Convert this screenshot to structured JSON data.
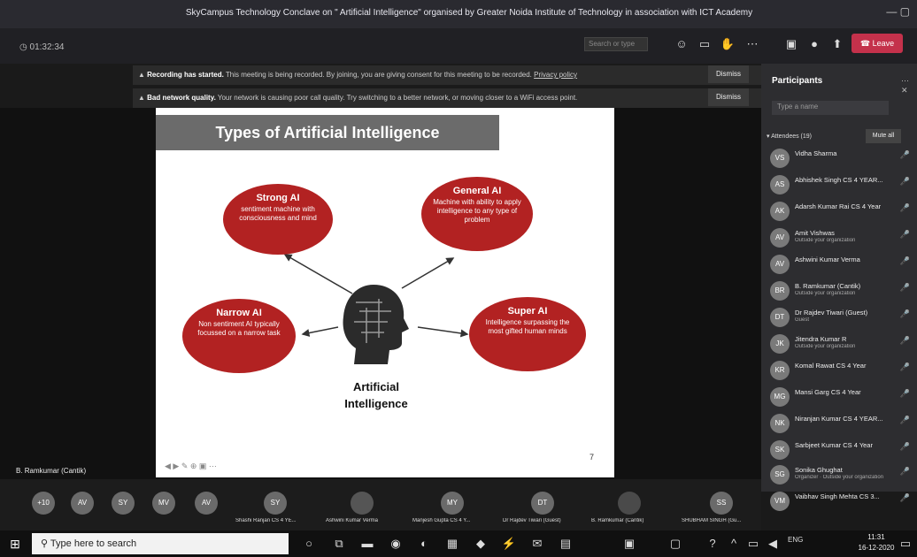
{
  "window": {
    "title": "SkyCampus Technology Conclave on \" Artificial Intelligence\" organised by Greater Noida Institute of Technology in association with ICT Academy"
  },
  "meeting": {
    "timer": "01:32:34",
    "search_placeholder": "Search or type",
    "leave_label": "Leave"
  },
  "banners": [
    {
      "bold": "Recording has started.",
      "text": "This meeting is being recorded. By joining, you are giving consent for this meeting to be recorded.",
      "link": "Privacy policy",
      "dismiss": "Dismiss"
    },
    {
      "bold": "Bad network quality.",
      "text": "Your network is causing poor call quality. Try switching to a better network, or moving closer to a WiFi access point.",
      "link": "",
      "dismiss": "Dismiss"
    }
  ],
  "slide": {
    "title": "Types of Artificial Intelligence",
    "strong": {
      "heading": "Strong AI",
      "desc": "sentiment machine with consciousness and mind"
    },
    "general": {
      "heading": "General AI",
      "desc": "Machine with ability to apply intelligence to any type of problem"
    },
    "narrow": {
      "heading": "Narrow AI",
      "desc": "Non sentiment AI typically focussed on a narrow task"
    },
    "super": {
      "heading": "Super AI",
      "desc": "Intelligence surpassing the most gifted human minds"
    },
    "center_line1": "Artificial",
    "center_line2": "Intelligence",
    "page_number": "7"
  },
  "presenter": {
    "name": "B. Ramkumar (Cantik)"
  },
  "panel": {
    "title": "Participants",
    "search_placeholder": "Type a name",
    "attendees_label": "Attendees (19)",
    "mute_all": "Mute all",
    "participants": [
      {
        "initials": "VS",
        "name": "Vidha Sharma",
        "sub": ""
      },
      {
        "initials": "AS",
        "name": "Abhishek Singh CS 4 YEAR...",
        "sub": ""
      },
      {
        "initials": "AK",
        "name": "Adarsh Kumar Rai CS 4 Year",
        "sub": ""
      },
      {
        "initials": "AV",
        "name": "Amit Vishwas",
        "sub": "Outside your organization"
      },
      {
        "initials": "AV",
        "name": "Ashwini Kumar Verma",
        "sub": ""
      },
      {
        "initials": "BR",
        "name": "B. Ramkumar (Cantik)",
        "sub": "Outside your organization"
      },
      {
        "initials": "DT",
        "name": "Dr Rajdev Tiwari (Guest)",
        "sub": "Guest"
      },
      {
        "initials": "JK",
        "name": "Jitendra Kumar R",
        "sub": "Outside your organization"
      },
      {
        "initials": "KR",
        "name": "Komal Rawat CS 4 Year",
        "sub": ""
      },
      {
        "initials": "MG",
        "name": "Mansi Garg CS 4 Year",
        "sub": ""
      },
      {
        "initials": "NK",
        "name": "Niranjan Kumar CS 4 YEAR...",
        "sub": ""
      },
      {
        "initials": "SK",
        "name": "Sarbjeet Kumar CS 4 Year",
        "sub": ""
      },
      {
        "initials": "SG",
        "name": "Sonika Ghughat",
        "sub": "Organizer · Outside your organization"
      },
      {
        "initials": "VM",
        "name": "Vaibhav Singh Mehta CS 3...",
        "sub": ""
      }
    ]
  },
  "strip": {
    "avatars": [
      "+10",
      "AV",
      "SY",
      "MV",
      "AV"
    ],
    "tiles": [
      {
        "initials": "SY",
        "name": "Shashi Ranjan CS 4 YE..."
      },
      {
        "initials": "",
        "name": "Ashwini Kumar Verma"
      },
      {
        "initials": "MY",
        "name": "Manjesh Gupta CS 4 Y..."
      },
      {
        "initials": "DT",
        "name": "Dr Rajdev Tiwari (Guest)"
      },
      {
        "initials": "",
        "name": "B. Ramkumar (Cantik)"
      },
      {
        "initials": "SS",
        "name": "SHUBHAM SINGH (Gu..."
      }
    ]
  },
  "taskbar": {
    "search_placeholder": "Type here to search",
    "lang": "ENG",
    "time": "11:31",
    "date": "16-12-2020"
  }
}
